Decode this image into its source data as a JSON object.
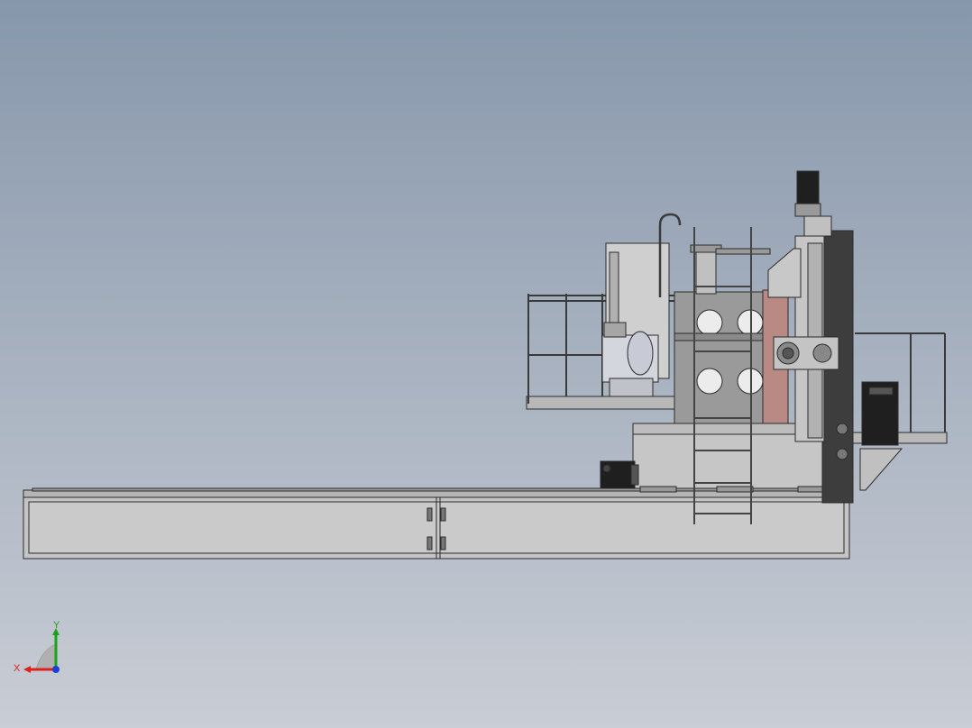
{
  "viewport": {
    "view": "front",
    "background": {
      "top": "#8797ab",
      "bottom": "#c9cdd5"
    }
  },
  "model": {
    "colors": {
      "body": "#c8c8c8",
      "body_dark": "#9a9a9a",
      "edge": "#2b2b2b",
      "column": "#3d3d3d",
      "slide_red": "#b98a84",
      "motor": "#1f1f1f",
      "tank": "#d4d6de",
      "platform": "#b8b8b8"
    }
  },
  "triad": {
    "x_label": "X",
    "y_label": "Y",
    "x_color": "#e0201c",
    "y_color": "#1aa31a",
    "z_color": "#1a3fd6"
  }
}
